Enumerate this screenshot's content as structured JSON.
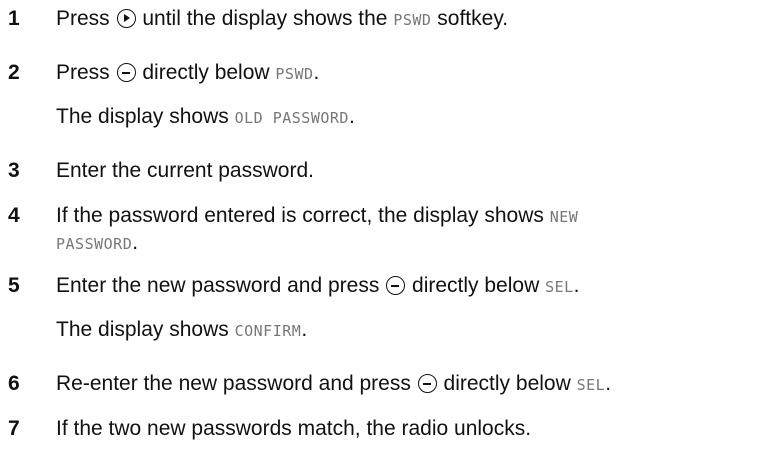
{
  "steps": [
    {
      "num": "1",
      "line1": {
        "a": "Press ",
        "b": " until the display shows the ",
        "disp1": "PSWD",
        "c": " softkey."
      }
    },
    {
      "num": "2",
      "line1": {
        "a": "Press ",
        "b": " directly below ",
        "disp1": "PSWD",
        "c": "."
      },
      "line2": {
        "a": "The display shows ",
        "disp1": "OLD PASSWORD",
        "b": "."
      }
    },
    {
      "num": "3",
      "line1": {
        "a": "Enter the current password."
      }
    },
    {
      "num": "4",
      "line1": {
        "a": "If the password entered is correct, the display shows ",
        "disp1": "NEW"
      },
      "line2": {
        "disp1": "PASSWORD",
        "b": "."
      }
    },
    {
      "num": "5",
      "line1": {
        "a": "Enter the new password and press ",
        "b": " directly below ",
        "disp1": "SEL",
        "c": "."
      },
      "line2": {
        "a": "The display shows ",
        "disp1": "CONFIRM",
        "b": "."
      }
    },
    {
      "num": "6",
      "line1": {
        "a": "Re-enter the new password and press ",
        "b": " directly below ",
        "disp1": "SEL",
        "c": "."
      }
    },
    {
      "num": "7",
      "line1": {
        "a": "If the two new passwords match, the radio unlocks."
      }
    }
  ],
  "icons": {
    "right_arrow": "right-arrow-button-icon",
    "minus": "minus-softkey-button-icon"
  }
}
